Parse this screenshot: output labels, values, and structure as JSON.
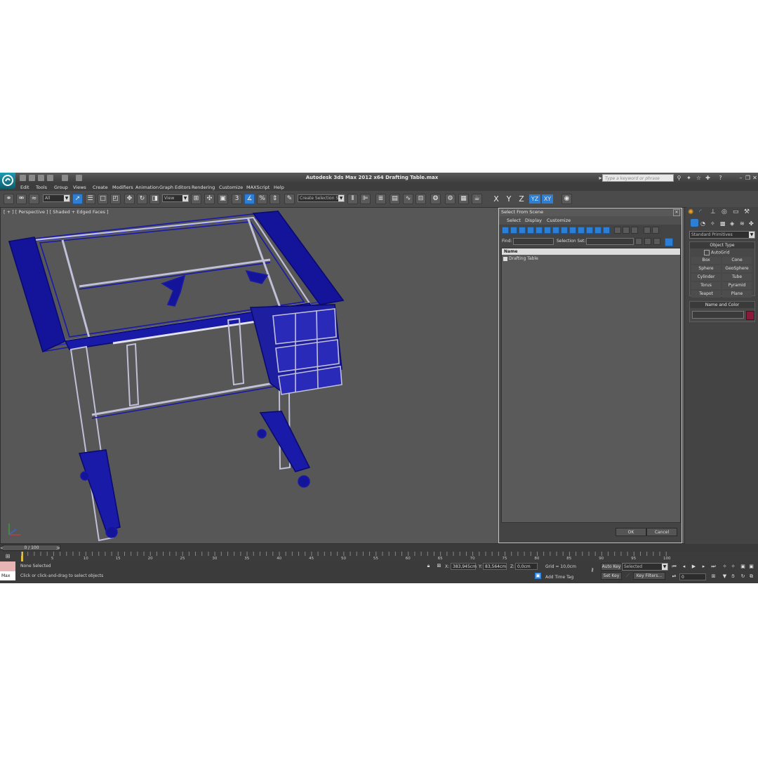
{
  "window": {
    "title": "Autodesk 3ds Max  2012 x64     Drafting Table.max",
    "search_placeholder": "Type a keyword or phrase"
  },
  "menu": [
    "Edit",
    "Tools",
    "Group",
    "Views",
    "Create",
    "Modifiers",
    "Animation",
    "Graph Editors",
    "Rendering",
    "Customize",
    "MAXScript",
    "Help"
  ],
  "toolbar": {
    "filter_value": "All",
    "ref_coord_value": "View",
    "selection_set_value": "Create Selection Se",
    "snap_label": "3",
    "axes": [
      "X",
      "Y",
      "Z",
      "YZ",
      "XY"
    ]
  },
  "viewport": {
    "label": "[ + ] [ Perspective ] [ Shaded + Edged Faces ]"
  },
  "dialog": {
    "title": "Select From Scene",
    "menu": [
      "Select",
      "Display",
      "Customize"
    ],
    "find_label": "Find:",
    "selection_set_label": "Selection Set:",
    "column_header": "Name",
    "items": [
      "Drafting Table"
    ],
    "ok": "OK",
    "cancel": "Cancel"
  },
  "command_panel": {
    "category": "Standard Primitives",
    "object_type_title": "Object Type",
    "autogrid": "AutoGrid",
    "primitives": [
      "Box",
      "Cone",
      "Sphere",
      "GeoSphere",
      "Cylinder",
      "Tube",
      "Torus",
      "Pyramid",
      "Teapot",
      "Plane"
    ],
    "name_color_title": "Name and Color",
    "object_color": "#8b1a3a"
  },
  "timeline": {
    "slider_label": "0 / 100",
    "ticks": [
      "5",
      "10",
      "15",
      "20",
      "25",
      "30",
      "35",
      "40",
      "45",
      "50",
      "55",
      "60",
      "65",
      "70",
      "75",
      "80",
      "85",
      "90",
      "95",
      "100"
    ]
  },
  "status": {
    "maxscript_label": "Max",
    "selection_status": "None Selected",
    "prompt": "Click or click-and-drag to select objects",
    "x_label": "X:",
    "x_value": "383,945cm",
    "y_label": "Y:",
    "y_value": "83,564cm",
    "z_label": "Z:",
    "z_value": "0,0cm",
    "grid": "Grid = 10,0cm",
    "add_time_tag": "Add Time Tag",
    "auto_key": "Auto Key",
    "set_key": "Set Key",
    "key_mode_value": "Selected",
    "key_filters": "Key Filters...",
    "frame_value": "0"
  },
  "colors": {
    "accent": "#2c7fd4",
    "wire": "#1a1aa8",
    "viewport_bg": "#575757"
  }
}
